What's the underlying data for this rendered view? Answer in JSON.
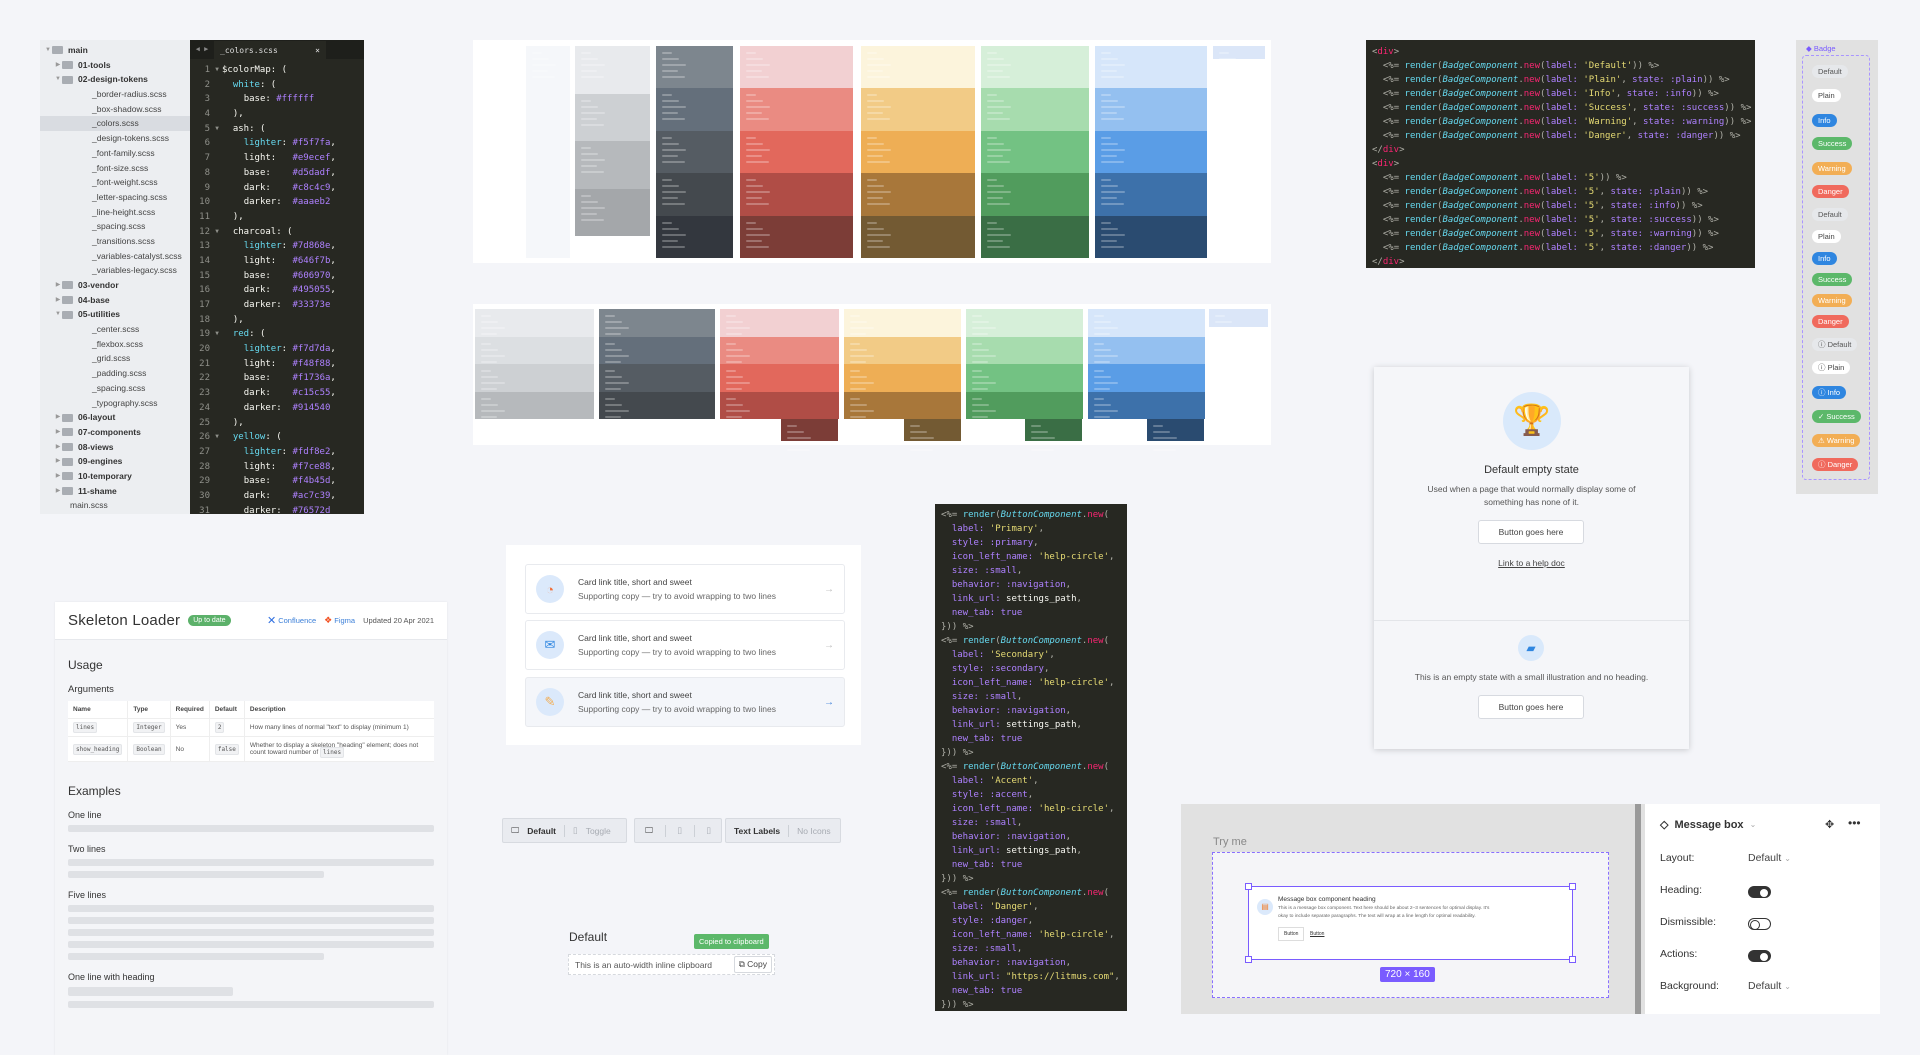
{
  "file_tree": [
    {
      "label": "main",
      "depth": 0,
      "type": "dir",
      "open": true
    },
    {
      "label": "01-tools",
      "depth": 1,
      "type": "dir",
      "open": false
    },
    {
      "label": "02-design-tokens",
      "depth": 1,
      "type": "dir",
      "open": true
    },
    {
      "label": "_border-radius.scss",
      "depth": 2,
      "type": "file"
    },
    {
      "label": "_box-shadow.scss",
      "depth": 2,
      "type": "file"
    },
    {
      "label": "_colors.scss",
      "depth": 2,
      "type": "file",
      "selected": true
    },
    {
      "label": "_design-tokens.scss",
      "depth": 2,
      "type": "file"
    },
    {
      "label": "_font-family.scss",
      "depth": 2,
      "type": "file"
    },
    {
      "label": "_font-size.scss",
      "depth": 2,
      "type": "file"
    },
    {
      "label": "_font-weight.scss",
      "depth": 2,
      "type": "file"
    },
    {
      "label": "_letter-spacing.scss",
      "depth": 2,
      "type": "file"
    },
    {
      "label": "_line-height.scss",
      "depth": 2,
      "type": "file"
    },
    {
      "label": "_spacing.scss",
      "depth": 2,
      "type": "file"
    },
    {
      "label": "_transitions.scss",
      "depth": 2,
      "type": "file"
    },
    {
      "label": "_variables-catalyst.scss",
      "depth": 2,
      "type": "file"
    },
    {
      "label": "_variables-legacy.scss",
      "depth": 2,
      "type": "file"
    },
    {
      "label": "03-vendor",
      "depth": 1,
      "type": "dir",
      "open": false
    },
    {
      "label": "04-base",
      "depth": 1,
      "type": "dir",
      "open": false
    },
    {
      "label": "05-utilities",
      "depth": 1,
      "type": "dir",
      "open": true
    },
    {
      "label": "_center.scss",
      "depth": 2,
      "type": "file"
    },
    {
      "label": "_flexbox.scss",
      "depth": 2,
      "type": "file"
    },
    {
      "label": "_grid.scss",
      "depth": 2,
      "type": "file"
    },
    {
      "label": "_padding.scss",
      "depth": 2,
      "type": "file"
    },
    {
      "label": "_spacing.scss",
      "depth": 2,
      "type": "file"
    },
    {
      "label": "_typography.scss",
      "depth": 2,
      "type": "file"
    },
    {
      "label": "06-layout",
      "depth": 1,
      "type": "dir",
      "open": false
    },
    {
      "label": "07-components",
      "depth": 1,
      "type": "dir",
      "open": false
    },
    {
      "label": "08-views",
      "depth": 1,
      "type": "dir",
      "open": false
    },
    {
      "label": "09-engines",
      "depth": 1,
      "type": "dir",
      "open": false
    },
    {
      "label": "10-temporary",
      "depth": 1,
      "type": "dir",
      "open": false
    },
    {
      "label": "11-shame",
      "depth": 1,
      "type": "dir",
      "open": false
    },
    {
      "label": "main.scss",
      "depth": 1,
      "type": "file"
    }
  ],
  "editor": {
    "tab": "_colors.scss",
    "close": "×",
    "nav": "◀ ▶",
    "folds": [
      1,
      5,
      12,
      19,
      26
    ],
    "lines": [
      "$colorMap: (",
      "  white: (",
      "    base: #ffffff",
      "  ),",
      "  ash: (",
      "    lighter: #f5f7fa,",
      "    light:   #e9ecef,",
      "    base:    #d5dadf,",
      "    dark:    #c8c4c9,",
      "    darker:  #aaaeb2",
      "  ),",
      "  charcoal: (",
      "    lighter: #7d868e,",
      "    light:   #646f7b,",
      "    base:    #606970,",
      "    dark:    #495055,",
      "    darker:  #33373e",
      "  ),",
      "  red: (",
      "    lighter: #f7d7da,",
      "    light:   #f48f88,",
      "    base:    #f1736a,",
      "    dark:    #c15c55,",
      "    darker:  #914540",
      "  ),",
      "  yellow: (",
      "    lighter: #fdf8e2,",
      "    light:   #f7ce88,",
      "    base:    #f4b45d,",
      "    dark:    #ac7c39,",
      "    darker:  #76572d",
      "  ),"
    ]
  },
  "badge_code": [
    "<div>",
    "  <%= render(BadgeComponent.new(label: 'Default')) %>",
    "  <%= render(BadgeComponent.new(label: 'Plain', state: :plain)) %>",
    "  <%= render(BadgeComponent.new(label: 'Info', state: :info)) %>",
    "  <%= render(BadgeComponent.new(label: 'Success', state: :success)) %>",
    "  <%= render(BadgeComponent.new(label: 'Warning', state: :warning)) %>",
    "  <%= render(BadgeComponent.new(label: 'Danger', state: :danger)) %>",
    "</div>",
    "<div>",
    "  <%= render(BadgeComponent.new(label: '5')) %>",
    "  <%= render(BadgeComponent.new(label: '5', state: :plain)) %>",
    "  <%= render(BadgeComponent.new(label: '5', state: :info)) %>",
    "  <%= render(BadgeComponent.new(label: '5', state: :success)) %>",
    "  <%= render(BadgeComponent.new(label: '5', state: :warning)) %>",
    "  <%= render(BadgeComponent.new(label: '5', state: :danger)) %>",
    "</div>"
  ],
  "button_code": [
    "<%= render(ButtonComponent.new(",
    "  label: 'Primary',",
    "  style: :primary,",
    "  icon_left_name: 'help-circle',",
    "  size: :small,",
    "  behavior: :navigation,",
    "  link_url: settings_path,",
    "  new_tab: true",
    "})) %>",
    "<%= render(ButtonComponent.new(",
    "  label: 'Secondary',",
    "  style: :secondary,",
    "  icon_left_name: 'help-circle',",
    "  size: :small,",
    "  behavior: :navigation,",
    "  link_url: settings_path,",
    "  new_tab: true",
    "})) %>",
    "<%= render(ButtonComponent.new(",
    "  label: 'Accent',",
    "  style: :accent,",
    "  icon_left_name: 'help-circle',",
    "  size: :small,",
    "  behavior: :navigation,",
    "  link_url: settings_path,",
    "  new_tab: true",
    "})) %>",
    "<%= render(ButtonComponent.new(",
    "  label: 'Danger',",
    "  style: :danger,",
    "  icon_left_name: 'help-circle',",
    "  size: :small,",
    "  behavior: :navigation,",
    "  link_url: \"https://litmus.com\",",
    "  new_tab: true",
    "})) %>"
  ],
  "badge_preview": {
    "title": "Badge",
    "badges": [
      {
        "label": "Default",
        "state": "default"
      },
      {
        "label": "Plain",
        "state": "plain"
      },
      {
        "label": "Info",
        "state": "info"
      },
      {
        "label": "Success",
        "state": "success"
      },
      {
        "label": "Warning",
        "state": "warning"
      },
      {
        "label": "Danger",
        "state": "danger"
      },
      {
        "label": "Default",
        "state": "default"
      },
      {
        "label": "Plain",
        "state": "plain"
      },
      {
        "label": "Info",
        "state": "info"
      },
      {
        "label": "Success",
        "state": "success"
      },
      {
        "label": "Warning",
        "state": "warning"
      },
      {
        "label": "Danger",
        "state": "danger"
      },
      {
        "label": "Default",
        "state": "default",
        "icon": "ⓘ"
      },
      {
        "label": "Plain",
        "state": "plain",
        "icon": "ⓘ"
      },
      {
        "label": "Info",
        "state": "info",
        "icon": "ⓘ"
      },
      {
        "label": "Success",
        "state": "success",
        "icon": "✓"
      },
      {
        "label": "Warning",
        "state": "warning",
        "icon": "⚠"
      },
      {
        "label": "Danger",
        "state": "danger",
        "icon": "ⓘ"
      }
    ],
    "colors": {
      "default": [
        "#e6e8eb",
        "#555"
      ],
      "plain": [
        "#ffffff",
        "#444"
      ],
      "info": [
        "#2f86e0",
        "#fff"
      ],
      "success": [
        "#5cb86a",
        "#fff"
      ],
      "warning": [
        "#f2ae55",
        "#fff"
      ],
      "danger": [
        "#f06a5d",
        "#fff"
      ]
    }
  },
  "swatches": {
    "ash": [
      "#e8eaed",
      "#cdd0d3",
      "#b6b9bc",
      "#a4a7aa"
    ],
    "charcoal": [
      "#7d868e",
      "#646f7b",
      "#555c63",
      "#44494e",
      "#33373e"
    ],
    "red": [
      "#f2d0d2",
      "#ea8b82",
      "#e2685c",
      "#b04d46",
      "#7c3d37"
    ],
    "yellow": [
      "#fcf4dc",
      "#f2cb86",
      "#eeae55",
      "#a8773a",
      "#735a33"
    ],
    "green": [
      "#d6efd9",
      "#a7dcae",
      "#73c283",
      "#519c5d",
      "#3a6e45"
    ],
    "blue": [
      "#d6e6fa",
      "#94c0f0",
      "#5a9de6",
      "#3d71aa",
      "#2a4b70"
    ],
    "tag": "#dbe6f8"
  },
  "doc": {
    "title": "Skeleton Loader",
    "status": "Up to date",
    "confluence": "Confluence",
    "figma": "Figma",
    "updated": "Updated 20 Apr 2021",
    "usage": "Usage",
    "arguments": "Arguments",
    "columns": [
      "Name",
      "Type",
      "Required",
      "Default",
      "Description"
    ],
    "rows": [
      {
        "name": "lines",
        "type": "Integer",
        "required": "Yes",
        "default": "2",
        "description": "How many lines of normal \"text\" to display (minimum 1)"
      },
      {
        "name": "show_heading",
        "type": "Boolean",
        "required": "No",
        "default": "false",
        "description": "Whether to display a skeleton \"heading\" element; does not count toward number of",
        "description_code": "lines"
      }
    ],
    "examples": "Examples",
    "example_titles": [
      "One line",
      "Two lines",
      "Five lines",
      "One line with heading"
    ]
  },
  "cards": [
    {
      "title": "Card link title, short and sweet",
      "sub": "Supporting copy — try to avoid wrapping to two lines",
      "icon": "◔"
    },
    {
      "title": "Card link title, short and sweet",
      "sub": "Supporting copy — try to avoid wrapping to two lines",
      "icon": "✉"
    },
    {
      "title": "Card link title, short and sweet",
      "sub": "Supporting copy — try to avoid wrapping to two lines",
      "icon": "✎"
    }
  ],
  "toolbar": {
    "default": "Default",
    "toggle": "Toggle",
    "text_labels": "Text Labels",
    "no_icons": "No Icons"
  },
  "clipboard": {
    "heading": "Default",
    "tooltip": "Copied to clipboard",
    "text": "This is an auto-width inline clipboard",
    "copy": "Copy"
  },
  "empty_state": {
    "title": "Default empty state",
    "desc1": "Used when a page that would normally display some of",
    "desc2": "something has none of it.",
    "button": "Button goes here",
    "link": "Link to a help doc",
    "desc_small": "This is an empty state with a small illustration and no heading.",
    "button2": "Button goes here"
  },
  "message_box": {
    "try_me": "Try me",
    "heading": "Message box component heading",
    "body1": "This is a message box component. Text here should be about 2–3 sentences for optimal display. It's",
    "body2": "okay to include separate paragraphs. The text will wrap at a line length for optimal readability.",
    "btn1": "Button",
    "btn2": "Button",
    "size": "720 × 160",
    "panel": {
      "title": "Message box",
      "layout_label": "Layout:",
      "layout_value": "Default",
      "heading_label": "Heading:",
      "heading_on": true,
      "dismissible_label": "Dismissible:",
      "dismissible_on": false,
      "actions_label": "Actions:",
      "actions_on": true,
      "background_label": "Background:",
      "background_value": "Default"
    }
  }
}
